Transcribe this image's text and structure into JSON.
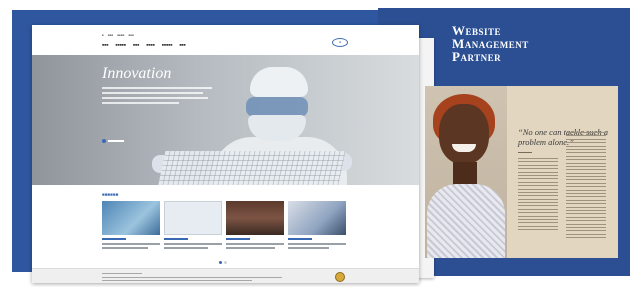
{
  "brochure": {
    "title_line1": "Website",
    "title_line2": "Management",
    "title_line3": "Partner",
    "quote": "“No one can tackle such a problem alone.”"
  },
  "website": {
    "hero_title": "Innovation",
    "accent_color": "#3a69b4",
    "logo_icon": "company-logo-icon",
    "thumbnail_count_visible": 4
  }
}
